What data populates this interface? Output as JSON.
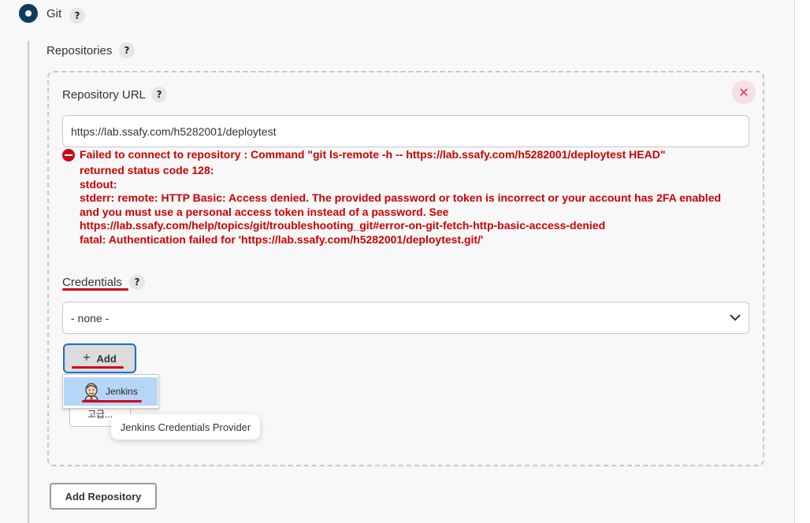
{
  "scm": {
    "option_label": "Git",
    "help": "?"
  },
  "repositories": {
    "label": "Repositories",
    "help": "?",
    "close_glyph": "✕",
    "repository_url": {
      "label": "Repository URL",
      "help": "?",
      "value": "https://lab.ssafy.com/h5282001/deploytest"
    },
    "error": {
      "line1": "Failed to connect to repository : Command \"git ls-remote -h -- https://lab.ssafy.com/h5282001/deploytest HEAD\"",
      "lines": [
        "returned status code 128:",
        "stdout:",
        "stderr: remote: HTTP Basic: Access denied. The provided password or token is incorrect or your account has 2FA enabled",
        "and you must use a personal access token instead of a password. See",
        "https://lab.ssafy.com/help/topics/git/troubleshooting_git#error-on-git-fetch-http-basic-access-denied",
        "fatal: Authentication failed for 'https://lab.ssafy.com/h5282001/deploytest.git/'"
      ]
    },
    "credentials": {
      "label": "Credentials",
      "help": "?",
      "selected": "- none -",
      "add_label": "Add",
      "add_glyph": "+",
      "menu_items": [
        "Jenkins"
      ],
      "advanced_label": "고급...",
      "tooltip": "Jenkins Credentials Provider"
    },
    "add_repository_label": "Add Repository"
  },
  "colors": {
    "error": "#cc0000",
    "accent": "#0c3c60",
    "highlight": "#d0021b"
  }
}
